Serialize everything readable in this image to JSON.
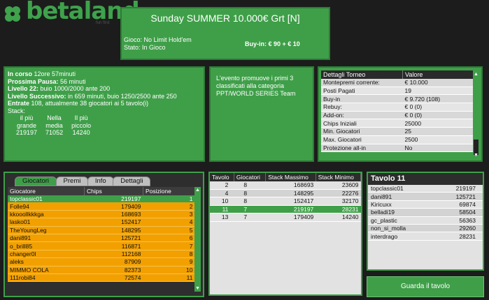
{
  "logo": {
    "text": "betaland",
    "tagline": "fun first"
  },
  "tournament": {
    "title": "Sunday SUMMER 10.000€ Grt   [N]",
    "gioco": "Gioco: No Limit Hold'em",
    "stato": "Stato: In Gioco",
    "buyin": "Buy-in: € 90 + € 10"
  },
  "status": {
    "in_corso_label": "In corso",
    "in_corso": " 12ore 57minuti",
    "prossima_label": "Prossima Pausa:",
    "prossima": " 56 minuti",
    "livello_label": "Livello 22:",
    "livello": " buio 1000/2000 ante 200",
    "successivo_label": "Livello Successivo:",
    "successivo": " in 659 minuti, buio 1250/2500 ante 250",
    "entrate_label": "Entrate",
    "entrate": " 108, attualmente 38 giocatori ai 5 tavolo(i)",
    "stack_label": "Stack:",
    "stack_headers": [
      "il più\ngrande",
      "Nella\nmedia",
      "Il più\npiccolo"
    ],
    "stack_h1a": "il più",
    "stack_h1b": "grande",
    "stack_h2a": "Nella",
    "stack_h2b": "media",
    "stack_h3a": "Il più",
    "stack_h3b": "piccolo",
    "stack_values": [
      "219197",
      "71052",
      "14240"
    ]
  },
  "info": {
    "text": "L'evento promuove i primi 3 classificati alla categoria PPT/WORLD SERIES Team"
  },
  "dettagli": {
    "headers": [
      "Dettagli Torneo",
      "Valore"
    ],
    "rows": [
      [
        "Montepremi corrente:",
        "€ 10.000"
      ],
      [
        "Posti Pagati",
        "19"
      ],
      [
        "Buy-in",
        "€ 9.720 (108)"
      ],
      [
        "Rebuy:",
        "€ 0 (0)"
      ],
      [
        "Add-on:",
        "€ 0 (0)"
      ],
      [
        "Chips Iniziali",
        "25000"
      ],
      [
        "Min. Giocatori",
        "25"
      ],
      [
        "Max. Giocatori",
        "2500"
      ],
      [
        "Protezione all-in",
        "No"
      ]
    ]
  },
  "players": {
    "tabs": [
      "Giocatori",
      "Premi",
      "Info",
      "Dettagli"
    ],
    "headers": [
      "Giocatore",
      "Chips",
      "Posizione"
    ],
    "rows": [
      [
        "topclassic01",
        "219197",
        "1"
      ],
      [
        "Folle94",
        "179409",
        "2"
      ],
      [
        "kkooollkkkga",
        "168693",
        "3"
      ],
      [
        "lasko01",
        "152417",
        "4"
      ],
      [
        "TheYoungLeg",
        "148295",
        "5"
      ],
      [
        "dani891",
        "125721",
        "6"
      ],
      [
        "o_brill85",
        "116871",
        "7"
      ],
      [
        "changer0l",
        "112168",
        "8"
      ],
      [
        "aleks",
        "87909",
        "9"
      ],
      [
        "MIMMO COLA",
        "82373",
        "10"
      ],
      [
        "111robi84",
        "72574",
        "11"
      ]
    ]
  },
  "tavoli": {
    "headers": [
      "Tavolo",
      "Giocatori",
      "Stack Massimo",
      "Stack Minimo"
    ],
    "rows": [
      [
        "2",
        "8",
        "168693",
        "23609"
      ],
      [
        "4",
        "8",
        "148295",
        "22276"
      ],
      [
        "10",
        "8",
        "152417",
        "32170"
      ],
      [
        "11",
        "7",
        "219197",
        "28231"
      ],
      [
        "13",
        "7",
        "179409",
        "14240"
      ]
    ]
  },
  "tavolo11": {
    "title": "Tavolo 11",
    "rows": [
      [
        "topclassic01",
        "219197"
      ],
      [
        "dani891",
        "125721"
      ],
      [
        "Kiricuxx",
        "69874"
      ],
      [
        "belladi19",
        "58504"
      ],
      [
        "gc_plastic",
        "56363"
      ],
      [
        "non_si_molla",
        "29260"
      ],
      [
        "interdrago",
        "28231"
      ]
    ]
  },
  "guarda_label": "Guarda il tavolo"
}
